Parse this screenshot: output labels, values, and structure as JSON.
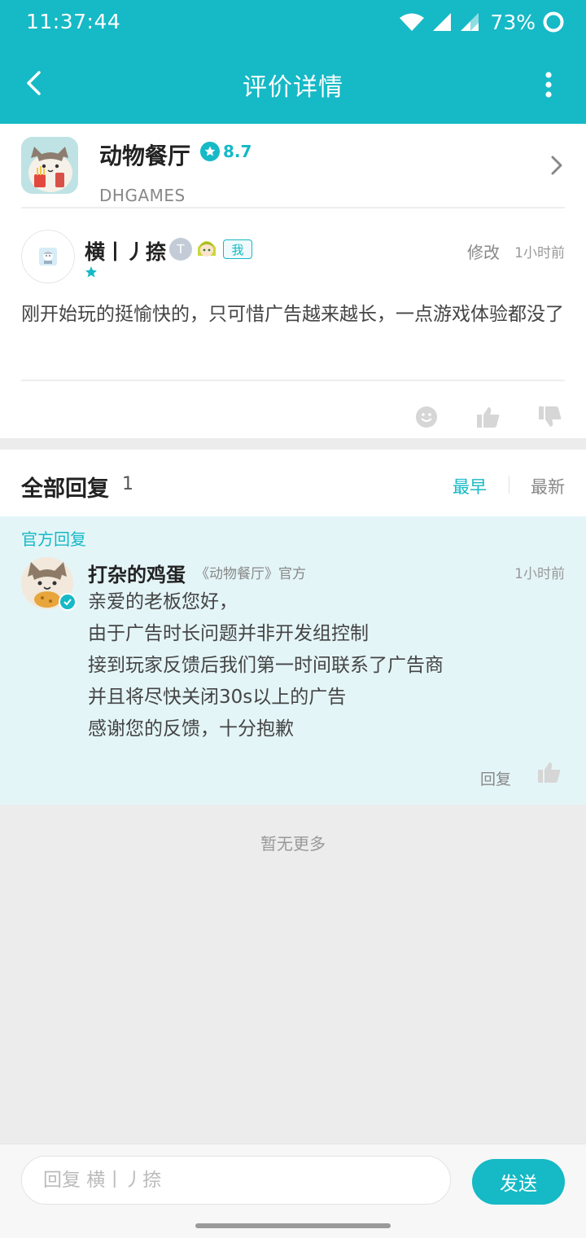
{
  "status_bar": {
    "time": "11:37:44",
    "battery": "73%"
  },
  "app_bar": {
    "title": "评价详情"
  },
  "game": {
    "name": "动物餐厅",
    "rating": "8.7",
    "developer": "DHGAMES"
  },
  "review": {
    "user_name": "横丨丿捺",
    "level": "T",
    "me_tag": "我",
    "edit": "修改",
    "time": "1小时前",
    "text": "刚开始玩的挺愉快的，只可惜广告越来越长，一点游戏体验都没了"
  },
  "replies": {
    "title": "全部回复",
    "count": "1",
    "sort_early": "最早",
    "sort_new": "最新"
  },
  "official_reply": {
    "label": "官方回复",
    "name": "打杂的鸡蛋",
    "game_tag": "《动物餐厅》官方",
    "time": "1小时前",
    "lines": [
      "亲爱的老板您好，",
      "由于广告时长问题并非开发组控制",
      "接到玩家反馈后我们第一时间联系了广告商",
      "并且将尽快关闭30s以上的广告",
      "感谢您的反馈，十分抱歉"
    ],
    "reply_label": "回复"
  },
  "no_more": "暂无更多",
  "input": {
    "placeholder": "回复 横丨丿捺",
    "send_label": "发送"
  },
  "colors": {
    "accent": "#16b9c6",
    "official_bg": "#e4f5f8"
  }
}
